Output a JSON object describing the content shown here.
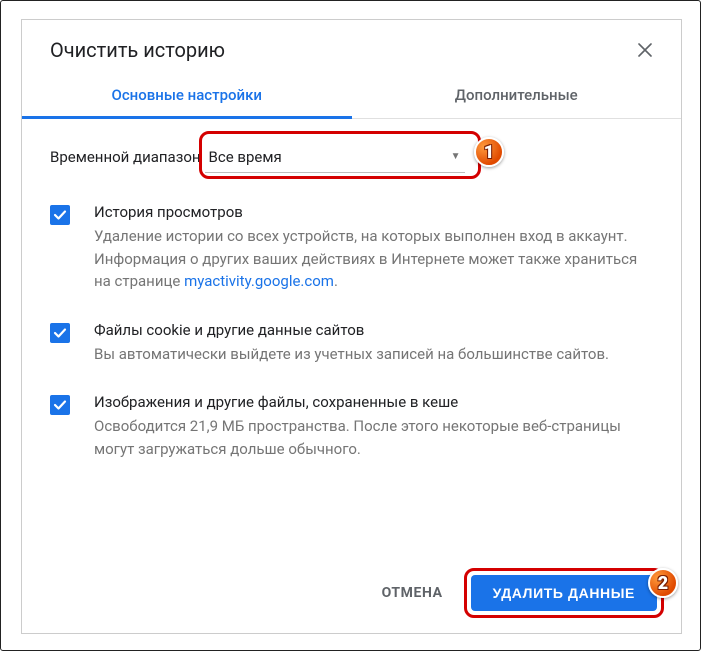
{
  "dialog": {
    "title": "Очистить историю",
    "tabs": {
      "basic": "Основные настройки",
      "advanced": "Дополнительные"
    },
    "range_label": "Временной диапазон",
    "range_value": "Все время",
    "items": [
      {
        "title": "История просмотров",
        "desc_pre": "Удаление истории со всех устройств, на которых выполнен вход в аккаунт. Информация о других ваших действиях в Интернете может также храниться на странице ",
        "link": "myactivity.google.com",
        "desc_post": "."
      },
      {
        "title": "Файлы cookie и другие данные сайтов",
        "desc": "Вы автоматически выйдете из учетных записей на большинстве сайтов."
      },
      {
        "title": "Изображения и другие файлы, сохраненные в кеше",
        "desc": "Освободится 21,9 МБ пространства. После этого некоторые веб-страницы могут загружаться дольше обычного."
      }
    ],
    "cancel": "ОТМЕНА",
    "confirm": "УДАЛИТЬ ДАННЫЕ"
  },
  "badges": {
    "one": "1",
    "two": "2"
  }
}
